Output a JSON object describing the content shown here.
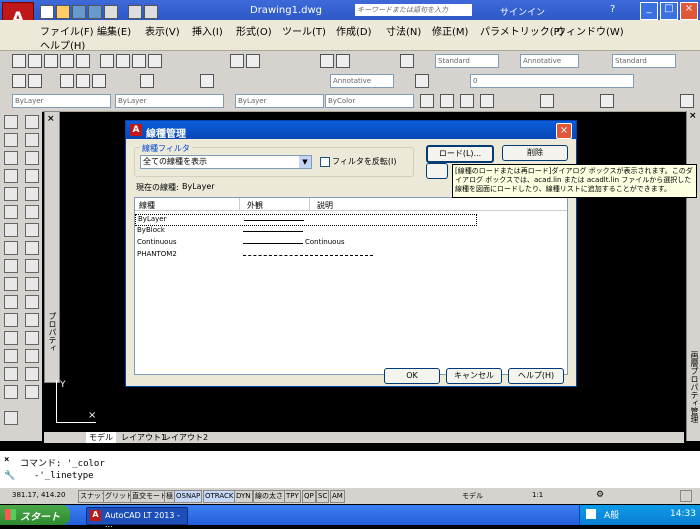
{
  "window": {
    "title": "Drawing1.dwg",
    "search_placeholder": "キーワードまたは語句を入力",
    "signin": "サインイン"
  },
  "menu": {
    "items": [
      "ファイル(F)",
      "編集(E)",
      "表示(V)",
      "挿入(I)",
      "形式(O)",
      "ツール(T)",
      "作成(D)",
      "寸法(N)",
      "修正(M)",
      "パラメトリック(P)",
      "ウィンドウ(W)",
      "ヘルプ(H)"
    ]
  },
  "toolbar": {
    "style1": "Standard",
    "style2": "Annotative",
    "style3": "Standard",
    "layer": "0",
    "annotative_label": "Annotative",
    "prop_bylayer1": "ByLayer",
    "prop_bylayer2": "ByLayer",
    "prop_bylayer3": "ByLayer",
    "prop_bycolor": "ByColor"
  },
  "dialog": {
    "title": "線種管理",
    "filter_label": "線種フィルタ",
    "filter_value": "全ての線種を表示",
    "invert_label": "フィルタを反転(I)",
    "load_button": "ロード(L)...",
    "delete_button": "削除",
    "current_label": "現在の線種:",
    "current_value": "ByLayer",
    "columns": [
      "線種",
      "外観",
      "説明"
    ],
    "rows": [
      {
        "name": "ByLayer",
        "desc": ""
      },
      {
        "name": "ByBlock",
        "desc": ""
      },
      {
        "name": "Continuous",
        "desc": "Continuous"
      },
      {
        "name": "PHANTOM2",
        "desc": ""
      }
    ],
    "ok_button": "OK",
    "cancel_button": "キャンセル",
    "help_button": "ヘルプ(H)",
    "tooltip": "[線種のロードまたは再ロード]ダイアログ ボックスが表示されます。このダイアログ ボックスでは、acad.lin または acadlt.lin ファイルから選択した線種を図面にロードしたり、線種リストに追加することができます。"
  },
  "drawing": {
    "tabs": [
      "モデル",
      "レイアウト1",
      "レイアウト2"
    ],
    "palette_label": "プロパティ",
    "right_palette_label": "画層プロパティ管理"
  },
  "command": {
    "line1": "コマンド: '_color",
    "line2": "-'_linetype"
  },
  "status": {
    "coords": "381.17, 414.20",
    "buttons": [
      "スナップ",
      "グリッド",
      "直交モード",
      "極",
      "OSNAP",
      "OTRACK",
      "DYN",
      "線の太さ",
      "TPY",
      "QP",
      "SC",
      "AM"
    ],
    "model": "モデル",
    "scale": "1:1"
  },
  "taskbar": {
    "start": "スタート",
    "task": "AutoCAD LT 2013 - ...",
    "clock": "14:33"
  }
}
